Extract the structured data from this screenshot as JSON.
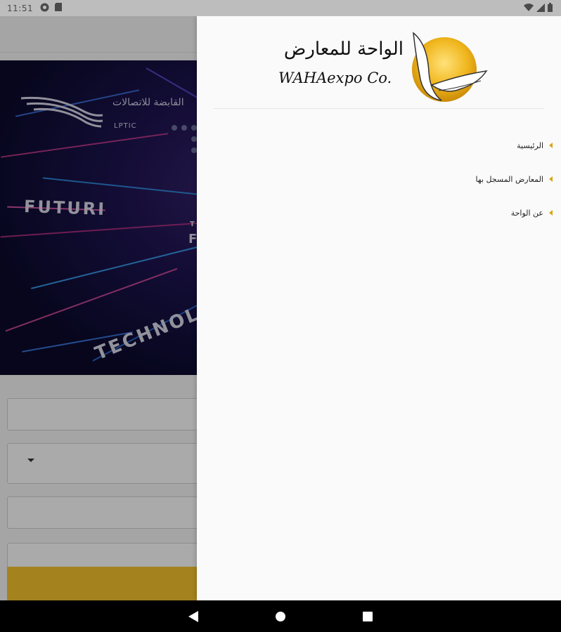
{
  "status_bar": {
    "time": "11:51",
    "left_icons": [
      "vpn-key-icon",
      "sim-card-icon"
    ],
    "right_icons": [
      "wifi-icon",
      "signal-icon",
      "battery-icon"
    ]
  },
  "background": {
    "banner": {
      "brand_ar": "القابضة للاتصالات",
      "brand_latin": "LPTIC",
      "words": [
        "FUTURI",
        "TECHNOLO",
        "F",
        "T"
      ]
    },
    "form": {
      "fields": [
        "",
        "",
        "",
        ""
      ],
      "dropdown_icon": "caret-down-icon",
      "accent": "#f2c12e"
    }
  },
  "drawer": {
    "brand": {
      "name_ar": "الواحة للمعارض",
      "name_latin": "WAHAexpo Co.",
      "logo": "waha-dove-sun-logo"
    },
    "menu": [
      {
        "label": "الرئيسية",
        "icon": "caret-left-icon"
      },
      {
        "label": "المعارض المسجل بها",
        "icon": "caret-left-icon"
      },
      {
        "label": "عن الواحة",
        "icon": "caret-left-icon"
      }
    ],
    "accent": "#d9a514"
  },
  "nav_bar": {
    "buttons": [
      "back-icon",
      "home-icon",
      "recents-icon"
    ]
  }
}
